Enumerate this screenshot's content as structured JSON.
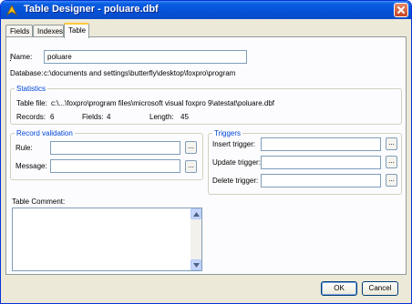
{
  "window": {
    "title": "Table Designer - poluare.dbf"
  },
  "tabs": [
    {
      "label": "Fields"
    },
    {
      "label": "Indexes"
    },
    {
      "label": "Table"
    }
  ],
  "name": {
    "label": "Name:",
    "value": "poluare"
  },
  "database": {
    "label": "Database:",
    "value": "c:\\documents and settings\\butterfly\\desktop\\foxpro\\program"
  },
  "statistics": {
    "legend": "Statistics",
    "table_file_label": "Table file:",
    "table_file_value": "c:\\...\\foxpro\\program files\\microsoft visual foxpro 9\\atestat\\poluare.dbf",
    "records_label": "Records:",
    "records_value": "6",
    "fields_label": "Fields:",
    "fields_value": "4",
    "length_label": "Length:",
    "length_value": "45"
  },
  "record_validation": {
    "legend": "Record validation",
    "rule_label": "Rule:",
    "rule_value": "",
    "message_label": "Message:",
    "message_value": ""
  },
  "triggers": {
    "legend": "Triggers",
    "insert_label": "Insert trigger:",
    "insert_value": "",
    "update_label": "Update trigger:",
    "update_value": "",
    "delete_label": "Delete trigger:",
    "delete_value": ""
  },
  "table_comment": {
    "label": "Table Comment:",
    "value": ""
  },
  "buttons": {
    "ellipsis": "...",
    "ok": "OK",
    "cancel": "Cancel"
  },
  "colors": {
    "titlebar": "#0551d6",
    "dialog_bg": "#ece9d8",
    "legend_text": "#0046d5",
    "active_tab_accent": "#ffc83c"
  }
}
